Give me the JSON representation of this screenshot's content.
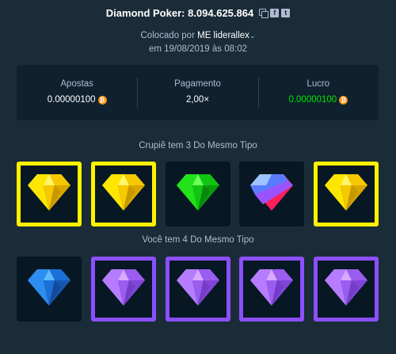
{
  "header": {
    "title": "Diamond Poker: 8.094.625.864",
    "icons": [
      "copy-icon",
      "facebook-icon",
      "twitter-icon"
    ]
  },
  "placed": {
    "prefix": "Colocado por",
    "user": "ME liderallex",
    "date": "em 19/08/2019 às 08:02"
  },
  "stats": [
    {
      "label": "Apostas",
      "value": "0.00000100",
      "coin": true
    },
    {
      "label": "Pagamento",
      "value": "2,00×",
      "coin": false
    },
    {
      "label": "Lucro",
      "value": "0.00000100",
      "coin": true,
      "color": "#00e701"
    }
  ],
  "dealer": {
    "label": "Crupiê tem 3 Do Mesmo Tipo",
    "gems": [
      {
        "gem": "yellow",
        "highlight": "yellow"
      },
      {
        "gem": "yellow",
        "highlight": "yellow"
      },
      {
        "gem": "green",
        "highlight": "none"
      },
      {
        "gem": "multicolor",
        "highlight": "none"
      },
      {
        "gem": "yellow",
        "highlight": "yellow"
      }
    ]
  },
  "player": {
    "label": "Você tem 4 Do Mesmo Tipo",
    "gems": [
      {
        "gem": "blue",
        "highlight": "none"
      },
      {
        "gem": "purple",
        "highlight": "purple"
      },
      {
        "gem": "purple",
        "highlight": "purple"
      },
      {
        "gem": "purple",
        "highlight": "purple"
      },
      {
        "gem": "purple",
        "highlight": "purple"
      }
    ]
  },
  "colors": {
    "background": "#1a2c38",
    "panel": "#0f212e",
    "profit": "#00e701",
    "yellow_highlight": "#fff200",
    "purple_highlight": "#8c4fff"
  }
}
